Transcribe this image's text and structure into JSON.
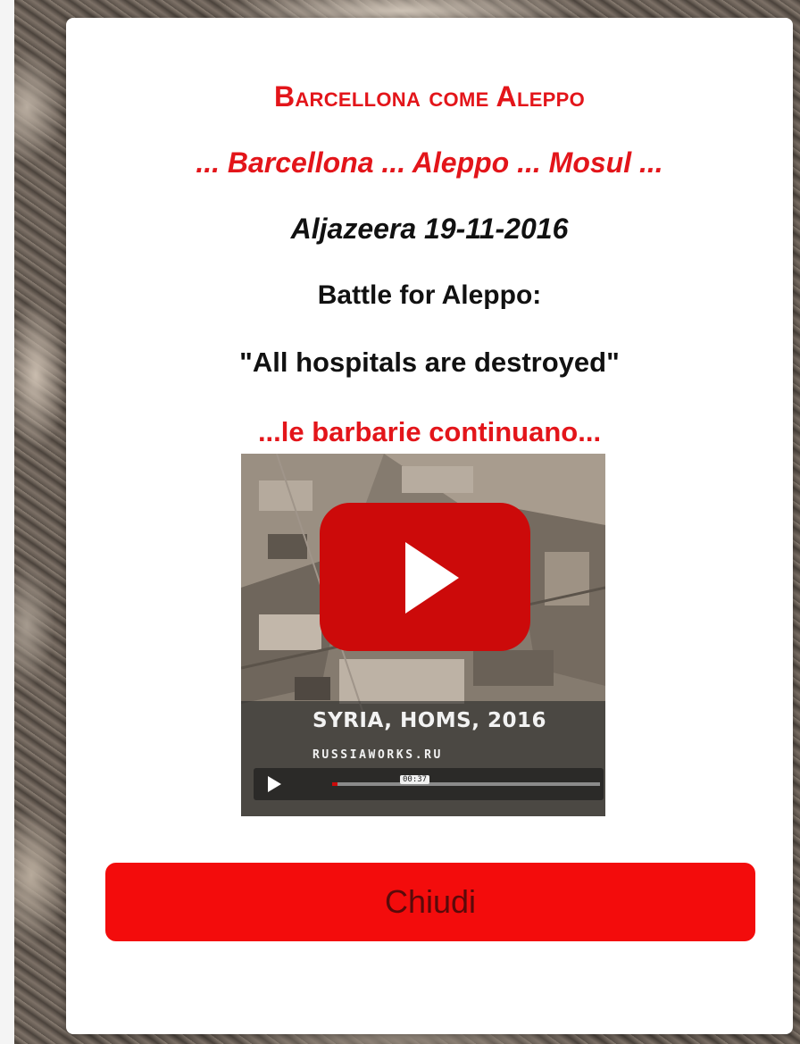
{
  "popup": {
    "title": "Barcellona come Aleppo",
    "subtitle": "... Barcellona ... Aleppo ... Mosul ...",
    "source": "Aljazeera 19-11-2016",
    "headline": "Battle for Aleppo:",
    "quote": "\"All hospitals are destroyed\"",
    "tagline": "...le barbarie continuano..."
  },
  "video": {
    "caption_title": "SYRIA, HOMS, 2016",
    "caption_site": "RUSSIAWORKS.RU",
    "timestamp": "00:37",
    "progress": 0.02
  },
  "close_button": {
    "label": "Chiudi"
  },
  "colors": {
    "accent_red": "#e3151a",
    "button_red": "#f30c0c",
    "play_red": "#cc0a0a"
  }
}
